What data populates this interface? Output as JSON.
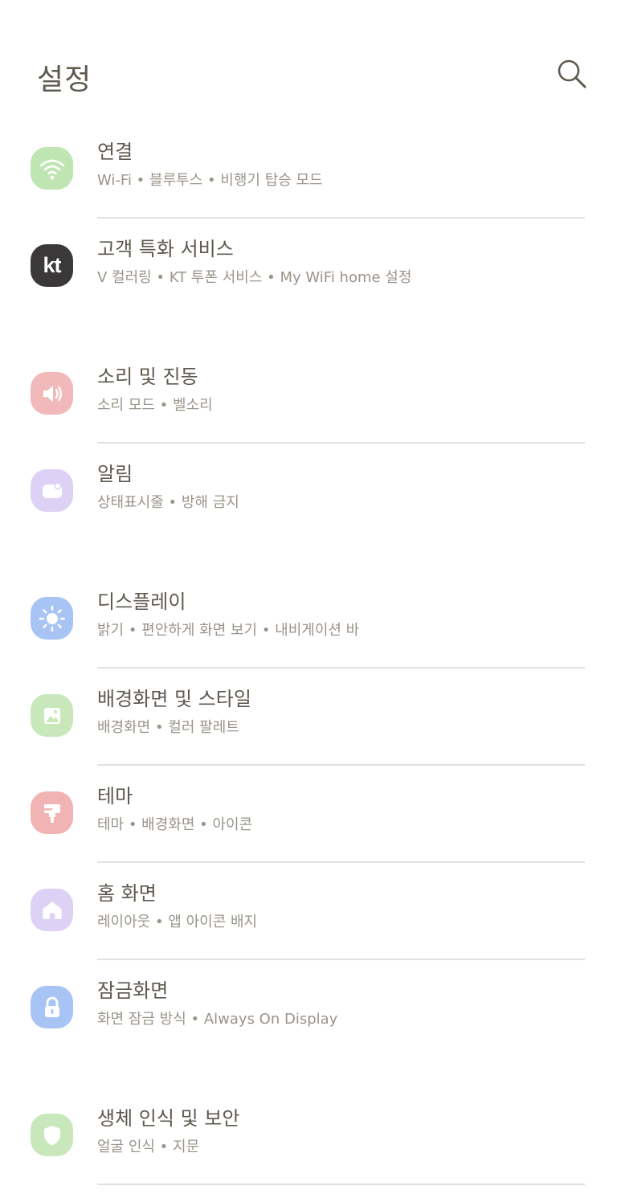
{
  "header": {
    "title": "설정",
    "search_icon": "search-icon"
  },
  "items": [
    {
      "label": "연결",
      "sub": "Wi-Fi  •  블루투스  •  비행기 탑승 모드",
      "icon": "wifi-icon",
      "color": "#bfe6b2"
    },
    {
      "label": "고객 특화 서비스",
      "sub": "V 컬러링  •  KT 투폰 서비스  •  My WiFi home 설정",
      "icon": "kt-logo-icon",
      "color": "#3a3838"
    },
    {
      "label": "소리 및 진동",
      "sub": "소리 모드  •  벨소리",
      "icon": "speaker-icon",
      "color": "#f1b9b9"
    },
    {
      "label": "알림",
      "sub": "상태표시줄  •  방해 금지",
      "icon": "notification-icon",
      "color": "#ddd1f5"
    },
    {
      "label": "디스플레이",
      "sub": "밝기  •  편안하게 화면 보기  •  내비게이션 바",
      "icon": "brightness-icon",
      "color": "#a8c4f5"
    },
    {
      "label": "배경화면 및 스타일",
      "sub": "배경화면  •  컬러 팔레트",
      "icon": "wallpaper-icon",
      "color": "#c8e8bc"
    },
    {
      "label": "테마",
      "sub": "테마  •  배경화면  •  아이콘",
      "icon": "paint-brush-icon",
      "color": "#f1b3b3"
    },
    {
      "label": "홈 화면",
      "sub": "레이아웃  •  앱 아이콘 배지",
      "icon": "home-icon",
      "color": "#ddd1f5"
    },
    {
      "label": "잠금화면",
      "sub": "화면 잠금 방식  •  Always On Display",
      "icon": "lock-icon",
      "color": "#a8c4f5"
    },
    {
      "label": "생체 인식 및 보안",
      "sub": "얼굴 인식  •  지문",
      "icon": "shield-icon",
      "color": "#c8e8bc"
    }
  ]
}
